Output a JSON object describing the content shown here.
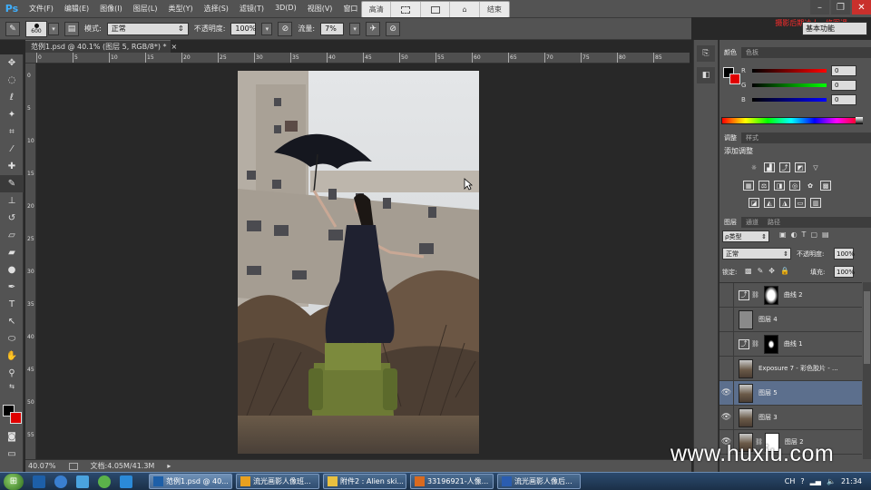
{
  "app": {
    "logo": "Ps"
  },
  "menu": [
    "文件(F)",
    "编辑(E)",
    "图像(I)",
    "图层(L)",
    "类型(Y)",
    "选择(S)",
    "滤镜(T)",
    "3D(D)",
    "视图(V)",
    "窗口"
  ],
  "float_toolbar": {
    "items": [
      "高清",
      "",
      "",
      "",
      "结束"
    ]
  },
  "watermark_top": "摄影后期达人 · 修图课",
  "options": {
    "brush_size": "600",
    "mode_label": "模式:",
    "mode_value": "正常",
    "opacity_label": "不透明度:",
    "opacity_value": "100%",
    "flow_label": "流量:",
    "flow_value": "7%"
  },
  "workspace": "基本功能",
  "document": {
    "tab_title": "范例1.psd @ 40.1% (图层 5, RGB/8*) *",
    "ruler_top": [
      "0",
      "5",
      "10",
      "15",
      "20",
      "25",
      "30",
      "35",
      "40",
      "45",
      "50",
      "55",
      "60",
      "65",
      "70",
      "75",
      "80",
      "85"
    ],
    "ruler_left": [
      "0",
      "5",
      "10",
      "15",
      "20",
      "25",
      "30",
      "35",
      "40",
      "45",
      "50",
      "55"
    ]
  },
  "status": {
    "zoom": "40.07%",
    "doc_info": "文档:4.05M/41.3M"
  },
  "color_panel": {
    "tabs": [
      "颜色",
      "色板"
    ],
    "channels": [
      {
        "letter": "R",
        "value": "0",
        "gradient": "linear-gradient(90deg,#000,#f00)"
      },
      {
        "letter": "G",
        "value": "0",
        "gradient": "linear-gradient(90deg,#000,#0f0)"
      },
      {
        "letter": "B",
        "value": "0",
        "gradient": "linear-gradient(90deg,#000,#00f)"
      }
    ]
  },
  "adjust_panel": {
    "tabs": [
      "调整",
      "样式"
    ],
    "title": "添加调整"
  },
  "layers_panel": {
    "tabs": [
      "图层",
      "通道",
      "路径"
    ],
    "filter_label": "ρ类型",
    "blend_mode": "正常",
    "opacity_label": "不透明度:",
    "opacity_value": "100%",
    "lock_label": "锁定:",
    "fill_label": "填充:",
    "fill_value": "100%",
    "layers": [
      {
        "name": "曲线 2",
        "visible": false,
        "selected": false,
        "kind": "curve-white"
      },
      {
        "name": "图层 4",
        "visible": false,
        "selected": false,
        "kind": "gray"
      },
      {
        "name": "曲线 1",
        "visible": false,
        "selected": false,
        "kind": "curve-black"
      },
      {
        "name": "Exposure 7 - 彩色胶片 - ...",
        "visible": false,
        "selected": false,
        "kind": "photo"
      },
      {
        "name": "图层 5",
        "visible": true,
        "selected": true,
        "kind": "photo"
      },
      {
        "name": "图层 3",
        "visible": true,
        "selected": false,
        "kind": "photo"
      },
      {
        "name": "图层 2",
        "visible": true,
        "selected": false,
        "kind": "photo-mask"
      }
    ]
  },
  "taskbar": {
    "tasks": [
      {
        "label": "范例1.psd @ 40...",
        "color": "#1d5fa8"
      },
      {
        "label": "流光画影人像班...",
        "color": "#e8a020"
      },
      {
        "label": "附件2 : Alien ski...",
        "color": "#e8c040"
      },
      {
        "label": "33196921-人像...",
        "color": "#d96a20"
      },
      {
        "label": "流光画影人像后...",
        "color": "#2a5db0"
      }
    ],
    "tray": {
      "lang": "CH",
      "time": "21:34"
    }
  },
  "site_watermark": "www.huxiu.com"
}
